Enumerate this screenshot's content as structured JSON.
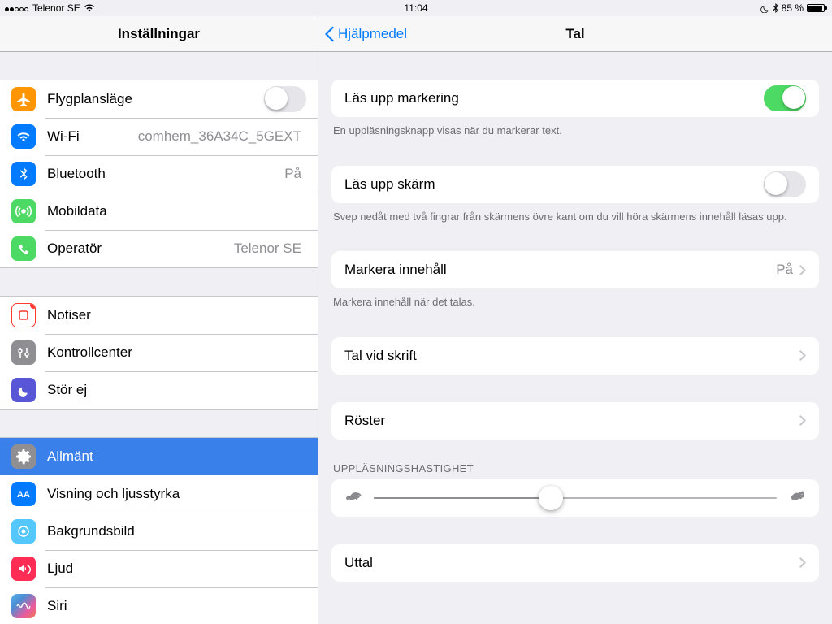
{
  "status": {
    "carrier": "Telenor SE",
    "time": "11:04",
    "battery_pct": "85 %"
  },
  "sidebar": {
    "title": "Inställningar",
    "group1": {
      "airplane": "Flygplansläge",
      "wifi_label": "Wi-Fi",
      "wifi_value": "comhem_36A34C_5GEXT",
      "bluetooth_label": "Bluetooth",
      "bluetooth_value": "På",
      "cellular": "Mobildata",
      "carrier_label": "Operatör",
      "carrier_value": "Telenor SE"
    },
    "group2": {
      "notifications": "Notiser",
      "control_center": "Kontrollcenter",
      "dnd": "Stör ej"
    },
    "group3": {
      "general": "Allmänt",
      "display": "Visning och ljusstyrka",
      "wallpaper": "Bakgrundsbild",
      "sound": "Ljud",
      "siri": "Siri"
    }
  },
  "detail": {
    "back": "Hjälpmedel",
    "title": "Tal",
    "speak_selection": "Läs upp markering",
    "speak_selection_footer": "En uppläsningsknapp visas när du markerar text.",
    "speak_screen": "Läs upp skärm",
    "speak_screen_footer": "Svep nedåt med två fingrar från skärmens övre kant om du vill höra skärmens innehåll läsas upp.",
    "highlight_label": "Markera innehåll",
    "highlight_value": "På",
    "highlight_footer": "Markera innehåll när det talas.",
    "typing_feedback": "Tal vid skrift",
    "voices": "Röster",
    "rate_header": "UPPLÄSNINGSHASTIGHET",
    "pronunciation": "Uttal",
    "slider_percent": 44
  }
}
